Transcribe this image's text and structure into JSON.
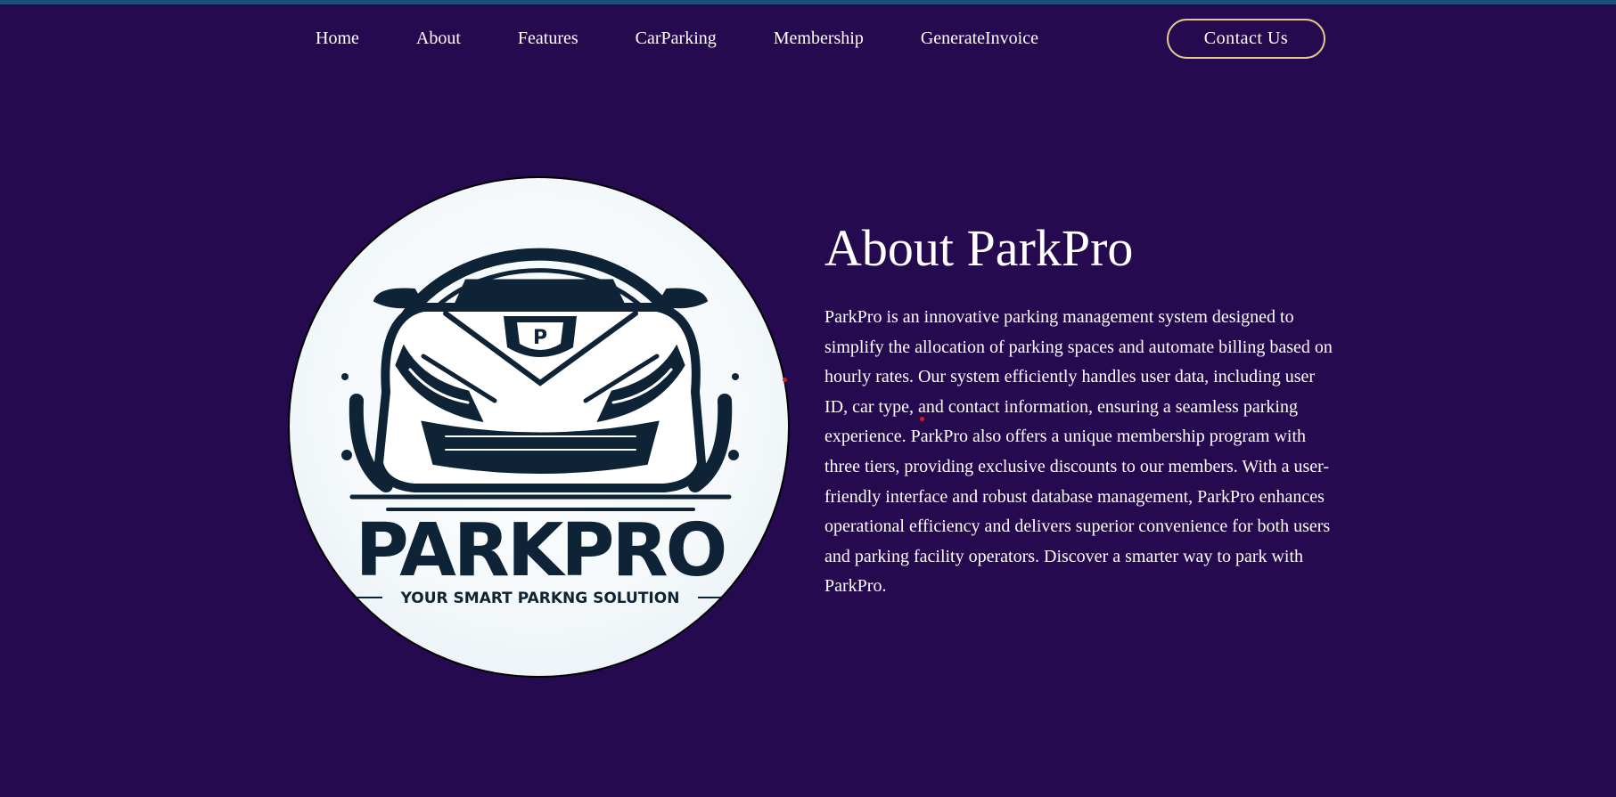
{
  "nav": {
    "links": [
      {
        "label": "Home"
      },
      {
        "label": "About"
      },
      {
        "label": "Features"
      },
      {
        "label": "CarParking"
      },
      {
        "label": "Membership"
      },
      {
        "label": "GenerateInvoice"
      }
    ],
    "contact_label": "Contact Us"
  },
  "hero": {
    "logo": {
      "brand": "PARKPRO",
      "tagline": "YOUR SMART PARKNG SOLUTION",
      "badge_letter": "P"
    },
    "title": "About ParkPro",
    "description": "ParkPro is an innovative parking management system designed to simplify the allocation of parking spaces and automate billing based on hourly rates. Our system efficiently handles user data, including user ID, car type, and contact information, ensuring a seamless parking experience. ParkPro also offers a unique membership program with three tiers, providing exclusive discounts to our members. With a user-friendly interface and robust database management, ParkPro enhances operational efficiency and delivers superior convenience for both users and parking facility operators. Discover a smarter way to park with ParkPro."
  },
  "colors": {
    "background": "#260a50",
    "top_strip": "#1d4f78",
    "button_border": "#e6c98a",
    "logo_navy": "#0e2436"
  }
}
